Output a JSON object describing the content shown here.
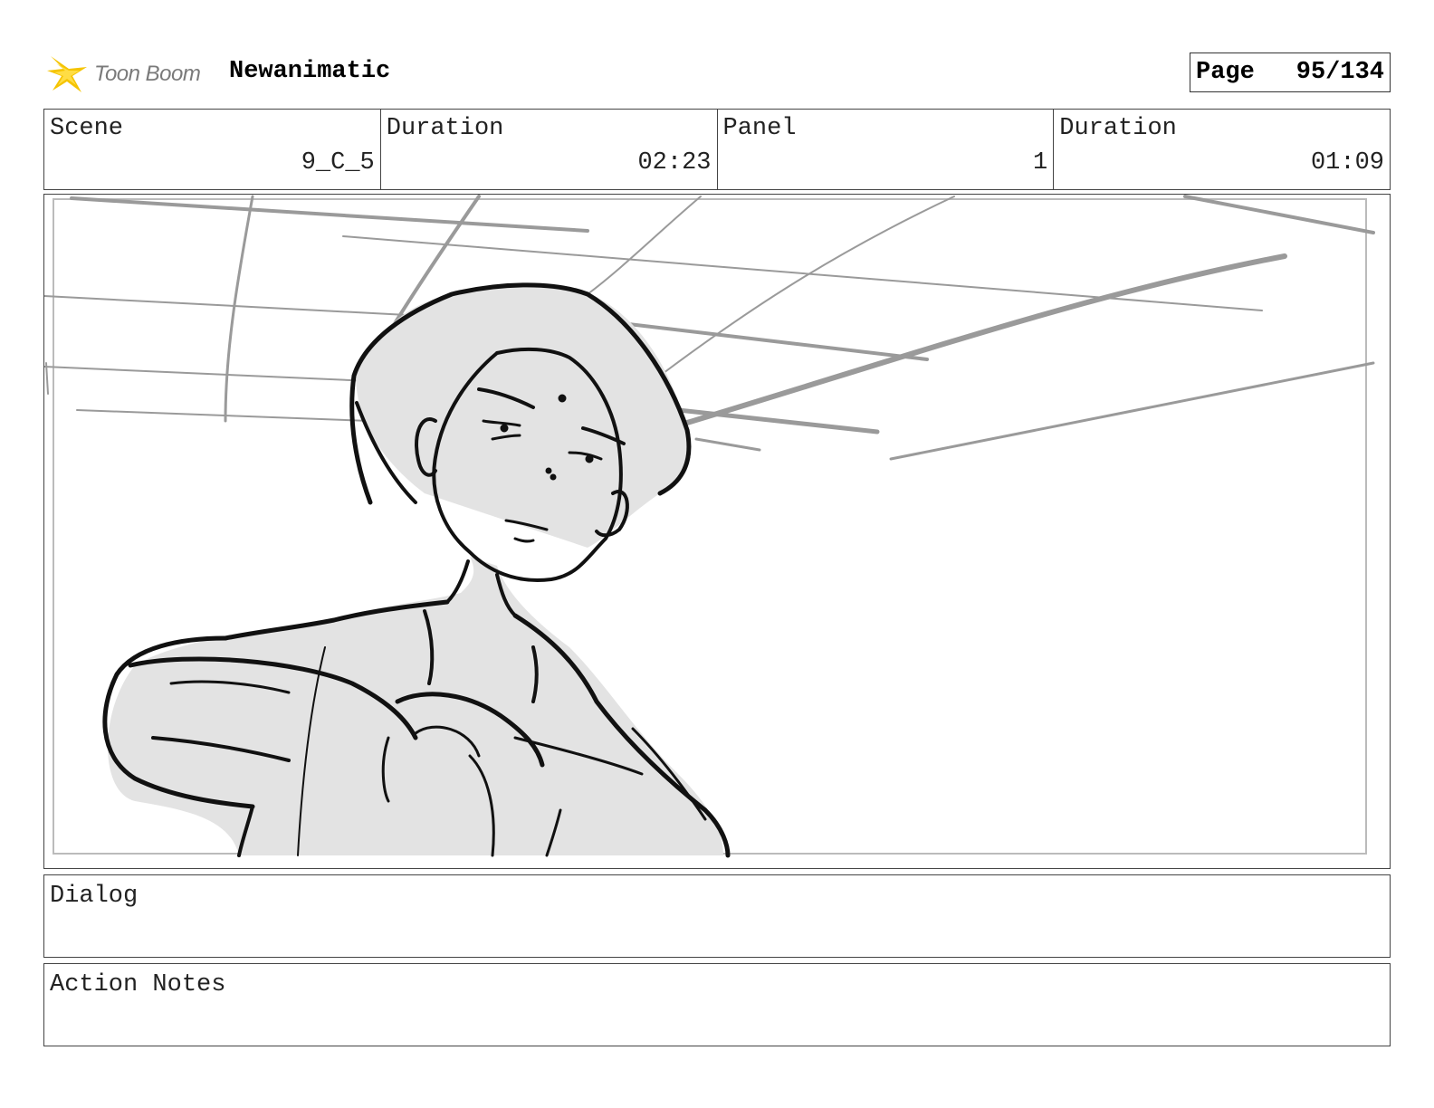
{
  "header": {
    "logo_text": "Toon Boom",
    "project_title": "Newanimatic",
    "page_label": "Page",
    "page_number": "95/134"
  },
  "info": {
    "scene_label": "Scene",
    "scene_value": "9_C_5",
    "scene_duration_label": "Duration",
    "scene_duration_value": "02:23",
    "panel_label": "Panel",
    "panel_value": "1",
    "panel_duration_label": "Duration",
    "panel_duration_value": "01:09"
  },
  "dialog": {
    "label": "Dialog",
    "text": ""
  },
  "action_notes": {
    "label": "Action Notes",
    "text": ""
  },
  "colors": {
    "logo_accent": "#f5c400",
    "sketch_line": "#111111",
    "sketch_fill": "#e3e3e3",
    "background_line": "#9a9a9a"
  },
  "icons": {
    "logo": "toon-boom-star-icon"
  }
}
